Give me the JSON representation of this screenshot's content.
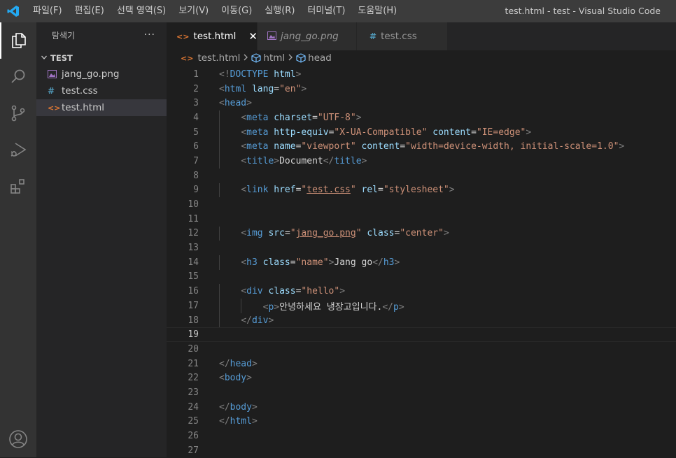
{
  "menu": [
    "파일(F)",
    "편집(E)",
    "선택 영역(S)",
    "보기(V)",
    "이동(G)",
    "실행(R)",
    "터미널(T)",
    "도움말(H)"
  ],
  "window_title": "test.html - test - Visual Studio Code",
  "sidebar": {
    "title": "탐색기",
    "more": "···",
    "folder": "TEST",
    "files": [
      {
        "name": "jang_go.png",
        "icon": "image-file-icon"
      },
      {
        "name": "test.css",
        "icon": "css-file-icon",
        "glyph": "#"
      },
      {
        "name": "test.html",
        "icon": "html-file-icon",
        "glyph": "<>"
      }
    ]
  },
  "tabs": [
    {
      "label": "test.html",
      "glyph": "<>",
      "close": "✕"
    },
    {
      "label": "jang_go.png"
    },
    {
      "label": "test.css",
      "glyph": "#"
    }
  ],
  "breadcrumb": [
    "test.html",
    "html",
    "head"
  ],
  "editor": {
    "current_line": 19,
    "line_numbers": [
      "1",
      "2",
      "3",
      "4",
      "5",
      "6",
      "7",
      "8",
      "9",
      "10",
      "11",
      "12",
      "13",
      "14",
      "15",
      "16",
      "17",
      "18",
      "19",
      "20",
      "21",
      "22",
      "23",
      "24",
      "25",
      "26",
      "27"
    ],
    "lines": [
      [
        [
          "<!",
          "br"
        ],
        [
          "DOCTYPE",
          "tag"
        ],
        [
          " ",
          "txt"
        ],
        [
          "html",
          "attr"
        ],
        [
          ">",
          "br"
        ]
      ],
      [
        [
          "<",
          "br"
        ],
        [
          "html",
          "tag"
        ],
        [
          " ",
          "txt"
        ],
        [
          "lang",
          "attr"
        ],
        [
          "=",
          "txt"
        ],
        [
          "\"en\"",
          "str"
        ],
        [
          ">",
          "br"
        ]
      ],
      [
        [
          "<",
          "br"
        ],
        [
          "head",
          "tag"
        ],
        [
          ">",
          "br"
        ]
      ],
      [
        [
          "    ",
          "txt"
        ],
        [
          "<",
          "br"
        ],
        [
          "meta",
          "tag"
        ],
        [
          " ",
          "txt"
        ],
        [
          "charset",
          "attr"
        ],
        [
          "=",
          "txt"
        ],
        [
          "\"UTF-8\"",
          "str"
        ],
        [
          ">",
          "br"
        ]
      ],
      [
        [
          "    ",
          "txt"
        ],
        [
          "<",
          "br"
        ],
        [
          "meta",
          "tag"
        ],
        [
          " ",
          "txt"
        ],
        [
          "http-equiv",
          "attr"
        ],
        [
          "=",
          "txt"
        ],
        [
          "\"X-UA-Compatible\"",
          "str"
        ],
        [
          " ",
          "txt"
        ],
        [
          "content",
          "attr"
        ],
        [
          "=",
          "txt"
        ],
        [
          "\"IE=edge\"",
          "str"
        ],
        [
          ">",
          "br"
        ]
      ],
      [
        [
          "    ",
          "txt"
        ],
        [
          "<",
          "br"
        ],
        [
          "meta",
          "tag"
        ],
        [
          " ",
          "txt"
        ],
        [
          "name",
          "attr"
        ],
        [
          "=",
          "txt"
        ],
        [
          "\"viewport\"",
          "str"
        ],
        [
          " ",
          "txt"
        ],
        [
          "content",
          "attr"
        ],
        [
          "=",
          "txt"
        ],
        [
          "\"width=device-width, initial-scale=1.0\"",
          "str"
        ],
        [
          ">",
          "br"
        ]
      ],
      [
        [
          "    ",
          "txt"
        ],
        [
          "<",
          "br"
        ],
        [
          "title",
          "tag"
        ],
        [
          ">",
          "br"
        ],
        [
          "Document",
          "txt"
        ],
        [
          "</",
          "br"
        ],
        [
          "title",
          "tag"
        ],
        [
          ">",
          "br"
        ]
      ],
      [],
      [
        [
          "    ",
          "txt"
        ],
        [
          "<",
          "br"
        ],
        [
          "link",
          "tag"
        ],
        [
          " ",
          "txt"
        ],
        [
          "href",
          "attr"
        ],
        [
          "=",
          "txt"
        ],
        [
          "\"",
          "str"
        ],
        [
          "test.css",
          "link"
        ],
        [
          "\"",
          "str"
        ],
        [
          " ",
          "txt"
        ],
        [
          "rel",
          "attr"
        ],
        [
          "=",
          "txt"
        ],
        [
          "\"stylesheet\"",
          "str"
        ],
        [
          ">",
          "br"
        ]
      ],
      [],
      [],
      [
        [
          "    ",
          "txt"
        ],
        [
          "<",
          "br"
        ],
        [
          "img",
          "tag"
        ],
        [
          " ",
          "txt"
        ],
        [
          "src",
          "attr"
        ],
        [
          "=",
          "txt"
        ],
        [
          "\"",
          "str"
        ],
        [
          "jang_go.png",
          "link"
        ],
        [
          "\"",
          "str"
        ],
        [
          " ",
          "txt"
        ],
        [
          "class",
          "attr"
        ],
        [
          "=",
          "txt"
        ],
        [
          "\"center\"",
          "str"
        ],
        [
          ">",
          "br"
        ]
      ],
      [],
      [
        [
          "    ",
          "txt"
        ],
        [
          "<",
          "br"
        ],
        [
          "h3",
          "tag"
        ],
        [
          " ",
          "txt"
        ],
        [
          "class",
          "attr"
        ],
        [
          "=",
          "txt"
        ],
        [
          "\"name\"",
          "str"
        ],
        [
          ">",
          "br"
        ],
        [
          "Jang go",
          "txt"
        ],
        [
          "</",
          "br"
        ],
        [
          "h3",
          "tag"
        ],
        [
          ">",
          "br"
        ]
      ],
      [],
      [
        [
          "    ",
          "txt"
        ],
        [
          "<",
          "br"
        ],
        [
          "div",
          "tag"
        ],
        [
          " ",
          "txt"
        ],
        [
          "class",
          "attr"
        ],
        [
          "=",
          "txt"
        ],
        [
          "\"hello\"",
          "str"
        ],
        [
          ">",
          "br"
        ]
      ],
      [
        [
          "        ",
          "txt"
        ],
        [
          "<",
          "br"
        ],
        [
          "p",
          "tag"
        ],
        [
          ">",
          "br"
        ],
        [
          "안녕하세요 냉장고입니다.",
          "txt"
        ],
        [
          "</",
          "br"
        ],
        [
          "p",
          "tag"
        ],
        [
          ">",
          "br"
        ]
      ],
      [
        [
          "    ",
          "txt"
        ],
        [
          "</",
          "br"
        ],
        [
          "div",
          "tag"
        ],
        [
          ">",
          "br"
        ]
      ],
      [],
      [],
      [
        [
          "</",
          "br"
        ],
        [
          "head",
          "tag"
        ],
        [
          ">",
          "br"
        ]
      ],
      [
        [
          "<",
          "br"
        ],
        [
          "body",
          "tag"
        ],
        [
          ">",
          "br"
        ]
      ],
      [],
      [
        [
          "</",
          "br"
        ],
        [
          "body",
          "tag"
        ],
        [
          ">",
          "br"
        ]
      ],
      [
        [
          "</",
          "br"
        ],
        [
          "html",
          "tag"
        ],
        [
          ">",
          "br"
        ]
      ],
      [],
      []
    ]
  },
  "colors": {
    "tag": "#569cd6",
    "attr": "#9cdcfe",
    "string": "#ce9178",
    "bracket": "#808080",
    "text": "#d4d4d4",
    "html_icon": "#e37933",
    "css_icon": "#519aba",
    "image_icon": "#a074c4",
    "vscode_blue": "#23a9f2"
  }
}
